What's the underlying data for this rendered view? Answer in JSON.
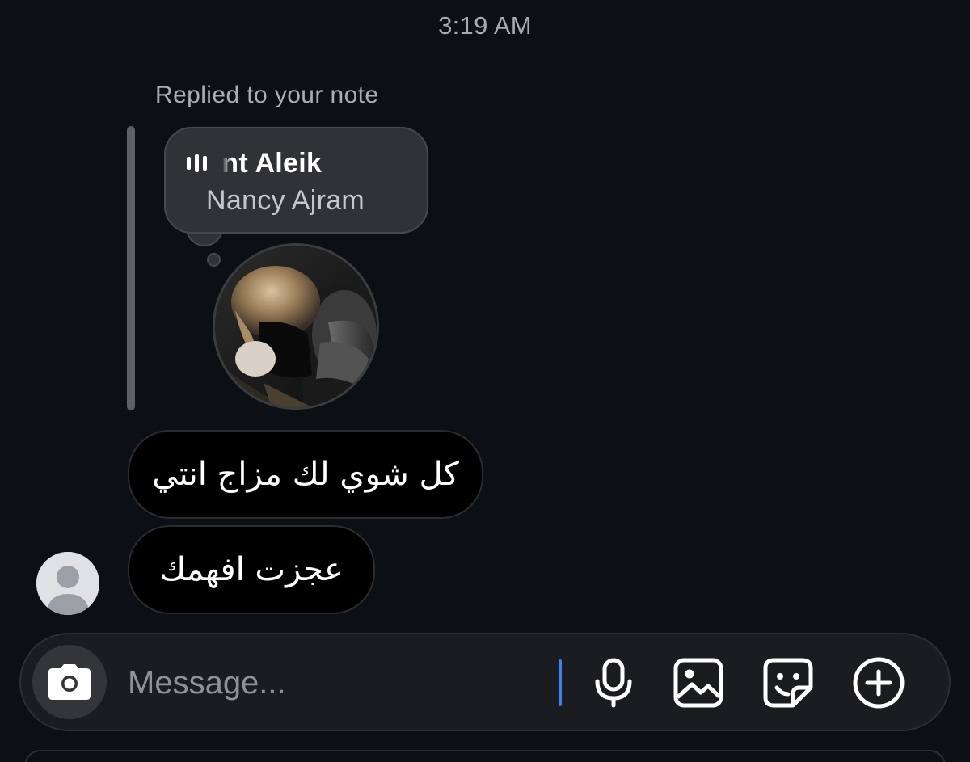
{
  "thread": {
    "timestamp": "3:19 AM",
    "reply_label": "Replied to your note"
  },
  "note": {
    "song_title": "hent Aleik",
    "artist": "Nancy Ajram",
    "song_icon": "audio-bars-icon",
    "avatar_icon": "profile-photo"
  },
  "messages": [
    {
      "text": "كل شوي لك مزاج انتي"
    },
    {
      "text": "عجزت افهمك"
    }
  ],
  "sender": {
    "avatar_icon": "default-avatar-icon"
  },
  "composer": {
    "placeholder": "Message...",
    "value": "",
    "camera_icon": "camera-icon",
    "mic_icon": "microphone-icon",
    "gallery_icon": "gallery-icon",
    "sticker_icon": "sticker-icon",
    "plus_icon": "plus-circle-icon",
    "caret_color": "#3b82f6"
  }
}
